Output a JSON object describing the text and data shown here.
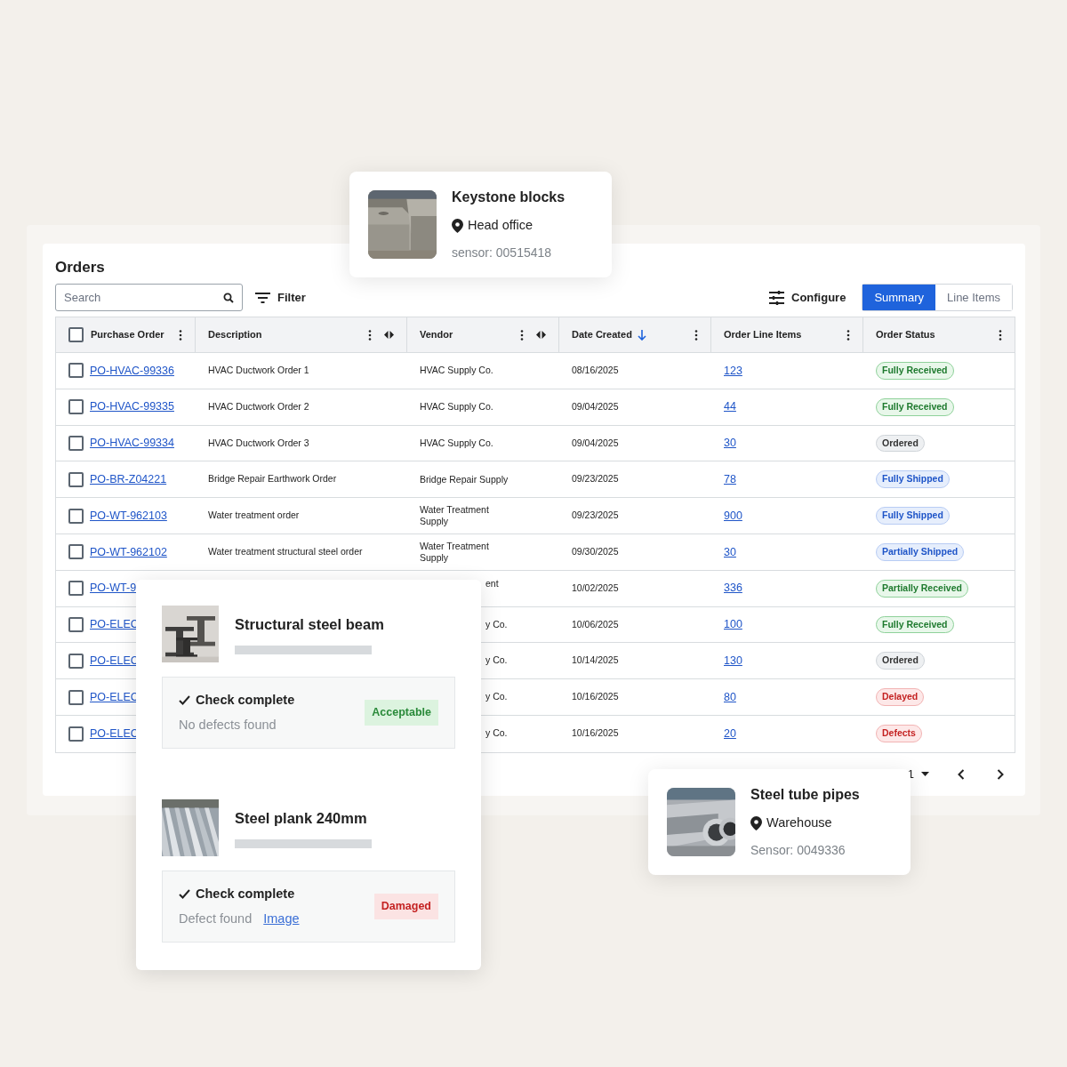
{
  "orders": {
    "title": "Orders",
    "search": {
      "placeholder": "Search"
    },
    "filter_label": "Filter",
    "configure_label": "Configure",
    "tabs": [
      {
        "label": "Summary",
        "selected": true
      },
      {
        "label": "Line Items",
        "selected": false
      }
    ],
    "select_all": {
      "checked": false
    },
    "columns": [
      {
        "label": "Purchase Order",
        "resizable": false,
        "sorted": false
      },
      {
        "label": "Description",
        "resizable": true,
        "sorted": false
      },
      {
        "label": "Vendor",
        "resizable": true,
        "sorted": false
      },
      {
        "label": "Date Created",
        "resizable": false,
        "sorted": true
      },
      {
        "label": "Order Line Items",
        "resizable": false,
        "sorted": false
      },
      {
        "label": "Order Status",
        "resizable": false,
        "sorted": false
      }
    ],
    "rows": [
      {
        "checked": false,
        "po": "PO-HVAC-99336",
        "description": "HVAC Ductwork Order 1",
        "vendor": "HVAC Supply Co.",
        "date": "08/16/2025",
        "line_items": "123",
        "status": {
          "label": "Fully Received",
          "kind": "received"
        }
      },
      {
        "checked": false,
        "po": "PO-HVAC-99335",
        "description": "HVAC Ductwork Order 2",
        "vendor": "HVAC Supply Co.",
        "date": "09/04/2025",
        "line_items": "44",
        "status": {
          "label": "Fully Received",
          "kind": "received"
        }
      },
      {
        "checked": false,
        "po": "PO-HVAC-99334",
        "description": "HVAC Ductwork Order 3",
        "vendor": "HVAC Supply Co.",
        "date": "09/04/2025",
        "line_items": "30",
        "status": {
          "label": "Ordered",
          "kind": "ordered"
        }
      },
      {
        "checked": false,
        "po": "PO-BR-Z04221",
        "description": "Bridge Repair Earthwork Order",
        "vendor": "Bridge Repair Supply",
        "date": "09/23/2025",
        "line_items": "78",
        "status": {
          "label": "Fully Shipped",
          "kind": "shipped"
        }
      },
      {
        "checked": false,
        "po": "PO-WT-962103",
        "description": "Water treatment order",
        "vendor": "Water Treatment Supply",
        "date": "09/23/2025",
        "line_items": "900",
        "status": {
          "label": "Fully Shipped",
          "kind": "shipped"
        }
      },
      {
        "checked": false,
        "po": "PO-WT-962102",
        "description": "Water treatment structural steel order",
        "vendor": "Water Treatment Supply",
        "date": "09/30/2025",
        "line_items": "30",
        "status": {
          "label": "Partially Shipped",
          "kind": "shipped"
        }
      },
      {
        "checked": false,
        "po": "PO-WT-9",
        "vendor_top": "ent",
        "date": "10/02/2025",
        "line_items": "336",
        "status": {
          "label": "Partially Received",
          "kind": "received"
        }
      },
      {
        "checked": false,
        "po": "PO-ELEC",
        "vendor_tail": "y Co.",
        "date": "10/06/2025",
        "line_items": "100",
        "status": {
          "label": "Fully Received",
          "kind": "received"
        }
      },
      {
        "checked": false,
        "po": "PO-ELEC",
        "vendor_tail": "y Co.",
        "date": "10/14/2025",
        "line_items": "130",
        "status": {
          "label": "Ordered",
          "kind": "ordered"
        }
      },
      {
        "checked": false,
        "po": "PO-ELEC",
        "vendor_tail": "y Co.",
        "date": "10/16/2025",
        "line_items": "80",
        "status": {
          "label": "Delayed",
          "kind": "problem"
        }
      },
      {
        "checked": false,
        "po": "PO-ELEC",
        "vendor_tail": "y Co.",
        "date": "10/16/2025",
        "line_items": "20",
        "status": {
          "label": "Defects",
          "kind": "problem"
        }
      }
    ],
    "page_select": "1"
  },
  "location_cards": [
    {
      "title": "Keystone blocks",
      "location": "Head office",
      "sensor": "sensor: 00515418",
      "kind": "blocks"
    },
    {
      "title": "Steel tube pipes",
      "location": "Warehouse",
      "sensor": "Sensor: 0049336",
      "kind": "pipes"
    }
  ],
  "inspections": [
    {
      "title": "Structural steel beam",
      "kind": "beam",
      "check": "Check complete",
      "detail": "No defects found",
      "verdict": {
        "label": "Acceptable",
        "kind": "ok"
      }
    },
    {
      "title": "Steel plank 240mm",
      "kind": "plank",
      "check": "Check complete",
      "detail": "Defect found",
      "link": "Image",
      "verdict": {
        "label": "Damaged",
        "kind": "bad"
      }
    }
  ]
}
